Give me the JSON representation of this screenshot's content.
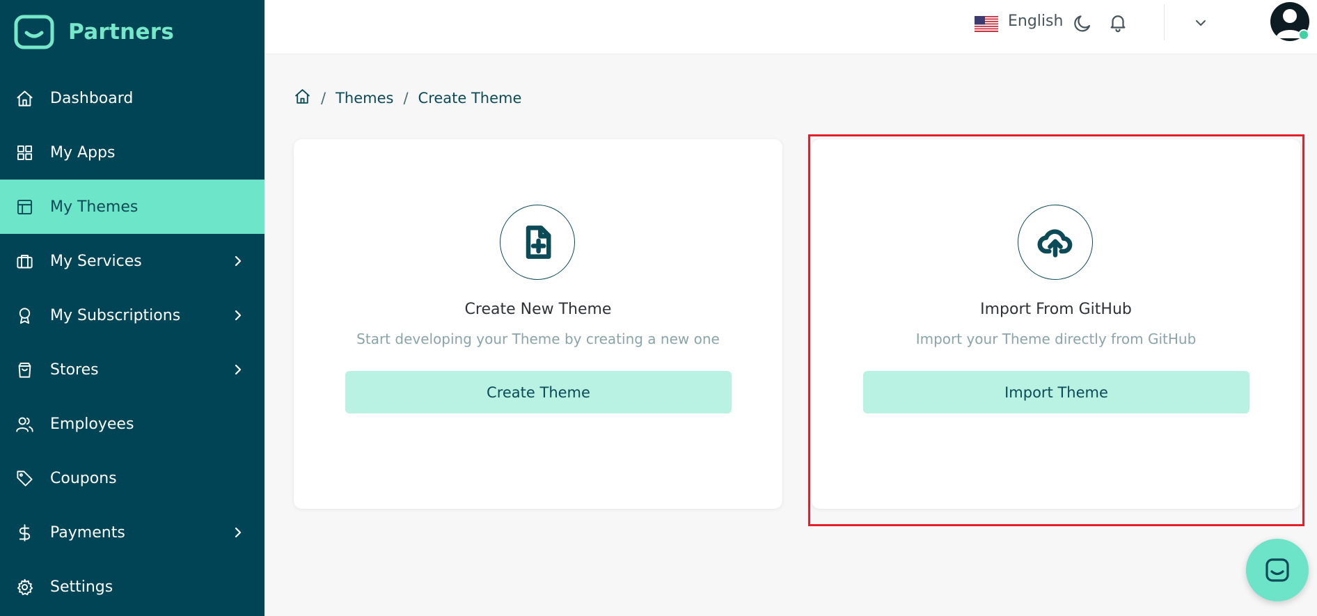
{
  "brand": {
    "name": "Partners",
    "icon": "partners-logo-icon"
  },
  "sidebar": {
    "items": [
      {
        "label": "Dashboard",
        "icon": "home-icon",
        "has_submenu": false,
        "active": false
      },
      {
        "label": "My Apps",
        "icon": "grid-icon",
        "has_submenu": false,
        "active": false
      },
      {
        "label": "My Themes",
        "icon": "layout-icon",
        "has_submenu": false,
        "active": true
      },
      {
        "label": "My Services",
        "icon": "briefcase-icon",
        "has_submenu": true,
        "active": false
      },
      {
        "label": "My Subscriptions",
        "icon": "award-icon",
        "has_submenu": true,
        "active": false
      },
      {
        "label": "Stores",
        "icon": "shopping-bag-icon",
        "has_submenu": true,
        "active": false
      },
      {
        "label": "Employees",
        "icon": "users-icon",
        "has_submenu": false,
        "active": false
      },
      {
        "label": "Coupons",
        "icon": "tag-icon",
        "has_submenu": false,
        "active": false
      },
      {
        "label": "Payments",
        "icon": "dollar-icon",
        "has_submenu": true,
        "active": false
      },
      {
        "label": "Settings",
        "icon": "gear-icon",
        "has_submenu": false,
        "active": false
      }
    ]
  },
  "header": {
    "language": "English",
    "language_icon": "us-flag-icon",
    "icons": [
      "moon-icon",
      "bell-icon",
      "chevron-down-icon",
      "avatar"
    ]
  },
  "breadcrumb": {
    "home_icon": "home-icon",
    "items": [
      "Themes",
      "Create Theme"
    ],
    "separator": "/"
  },
  "cards": [
    {
      "icon": "file-plus-icon",
      "title": "Create New Theme",
      "description": "Start developing your Theme by creating a new one",
      "button": "Create Theme"
    },
    {
      "icon": "cloud-upload-icon",
      "title": "Import From GitHub",
      "description": "Import your Theme directly from GitHub",
      "button": "Import Theme"
    }
  ],
  "colors": {
    "sidebar_bg": "#004455",
    "accent": "#6ce5c9",
    "button_bg": "#b9f1e2",
    "highlight": "#e3202a"
  },
  "chat": {
    "icon": "chat-icon"
  }
}
